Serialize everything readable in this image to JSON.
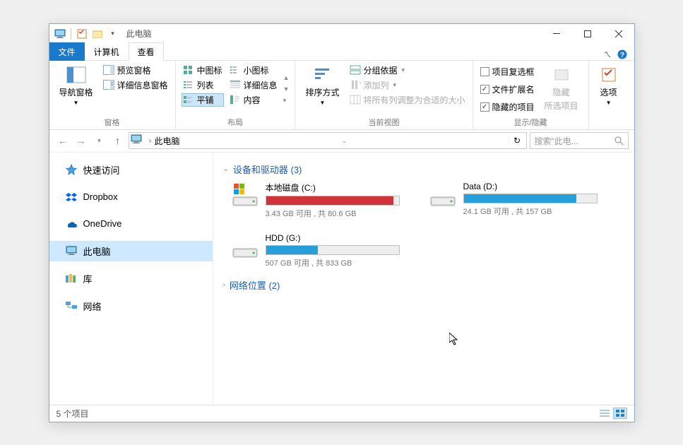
{
  "titlebar": {
    "title": "此电脑"
  },
  "tabs": {
    "file": "文件",
    "computer": "计算机",
    "view": "查看"
  },
  "ribbon": {
    "panes": {
      "nav_pane": "导航窗格",
      "preview_pane": "预览窗格",
      "details_pane": "详细信息窗格",
      "label": "窗格"
    },
    "layout": {
      "medium_icons": "中图标",
      "small_icons": "小图标",
      "list": "列表",
      "details": "详细信息",
      "tiles": "平铺",
      "content": "内容",
      "label": "布局"
    },
    "current_view": {
      "sort_by": "排序方式",
      "group_by": "分组依据",
      "add_columns": "添加列",
      "size_all": "将所有列调整为合适的大小",
      "label": "当前视图"
    },
    "show_hide": {
      "item_checkboxes": "项目复选框",
      "file_ext": "文件扩展名",
      "hidden_items": "隐藏的项目",
      "hide_selected": "隐藏",
      "hide_selected2": "所选项目",
      "label": "显示/隐藏"
    },
    "options": {
      "label": "选项"
    }
  },
  "address": {
    "location": "此电脑",
    "search_placeholder": "搜索\"此电..."
  },
  "sidebar": {
    "items": [
      {
        "label": "快速访问"
      },
      {
        "label": "Dropbox"
      },
      {
        "label": "OneDrive"
      },
      {
        "label": "此电脑"
      },
      {
        "label": "库"
      },
      {
        "label": "网络"
      }
    ]
  },
  "main": {
    "group_drives": "设备和驱动器 (3)",
    "group_network": "网络位置 (2)",
    "drives": [
      {
        "name": "本地磁盘 (C:)",
        "stats": "3.43 GB 可用 , 共 80.6 GB",
        "fill": 96,
        "critical": true,
        "type": "os"
      },
      {
        "name": "Data (D:)",
        "stats": "24.1 GB 可用 , 共 157 GB",
        "fill": 85,
        "critical": false,
        "type": "hdd"
      },
      {
        "name": "HDD (G:)",
        "stats": "507 GB 可用 , 共 833 GB",
        "fill": 39,
        "critical": false,
        "type": "hdd"
      }
    ]
  },
  "status": {
    "items": "5 个项目"
  }
}
